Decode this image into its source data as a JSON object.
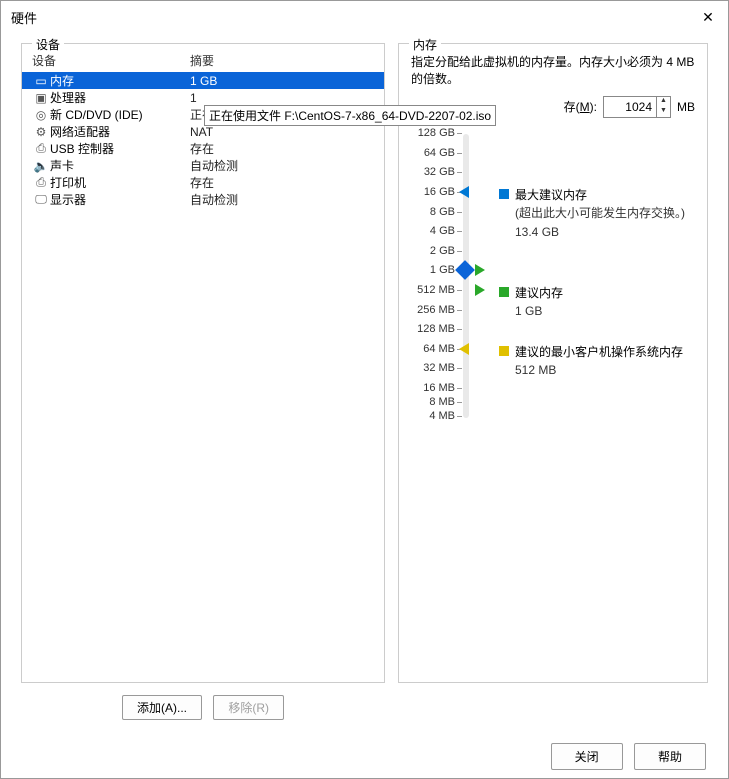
{
  "window": {
    "title": "硬件"
  },
  "panels": {
    "left_label": "设备",
    "right_label": "内存"
  },
  "headers": {
    "device": "设备",
    "summary": "摘要"
  },
  "devices": [
    {
      "icon": "▭",
      "name": "内存",
      "summary": "1 GB",
      "selected": true
    },
    {
      "icon": "▣",
      "name": "处理器",
      "summary": "1"
    },
    {
      "icon": "◎",
      "name": "新 CD/DVD (IDE)",
      "summary": "正在使用文件 F:\\CentOS-7-x86_6...",
      "tooltip": "正在使用文件 F:\\CentOS-7-x86_64-DVD-2207-02.iso"
    },
    {
      "icon": "⚙",
      "name": "网络适配器",
      "summary": "NAT"
    },
    {
      "icon": "⎙",
      "name": "USB 控制器",
      "summary": "存在"
    },
    {
      "icon": "🔈",
      "name": "声卡",
      "summary": "自动检测"
    },
    {
      "icon": "⎙",
      "name": "打印机",
      "summary": "存在"
    },
    {
      "icon": "🖵",
      "name": "显示器",
      "summary": "自动检测"
    }
  ],
  "buttons": {
    "add": "添加(A)...",
    "remove": "移除(R)",
    "close": "关闭",
    "help": "帮助"
  },
  "memory": {
    "desc": "指定分配给此虚拟机的内存量。内存大小必须为 4 MB 的倍数。",
    "label_prefix": "存(",
    "label_hotkey": "M",
    "label_suffix": "):",
    "value": "1024",
    "unit": "MB"
  },
  "ticks": [
    {
      "label": "128 GB",
      "pct": 2
    },
    {
      "label": "64 GB",
      "pct": 9
    },
    {
      "label": "32 GB",
      "pct": 16
    },
    {
      "label": "16 GB",
      "pct": 23
    },
    {
      "label": "8 GB",
      "pct": 30
    },
    {
      "label": "4 GB",
      "pct": 37
    },
    {
      "label": "2 GB",
      "pct": 44
    },
    {
      "label": "1 GB",
      "pct": 51
    },
    {
      "label": "512 MB",
      "pct": 58
    },
    {
      "label": "256 MB",
      "pct": 65
    },
    {
      "label": "128 MB",
      "pct": 72
    },
    {
      "label": "64 MB",
      "pct": 79
    },
    {
      "label": "32 MB",
      "pct": 86
    },
    {
      "label": "16 MB",
      "pct": 93
    },
    {
      "label": "8 MB",
      "pct": 98
    },
    {
      "label": "4 MB",
      "pct": 103
    }
  ],
  "markers": {
    "max": {
      "pct": 23,
      "title": "最大建议内存",
      "note": "(超出此大小可能发生内存交换。)",
      "val": "13.4 GB"
    },
    "rec": {
      "pct": 58,
      "title": "建议内存",
      "val": "1 GB"
    },
    "min": {
      "pct": 79,
      "title": "建议的最小客户机操作系统内存",
      "val": "512 MB"
    },
    "current_pct": 51
  }
}
